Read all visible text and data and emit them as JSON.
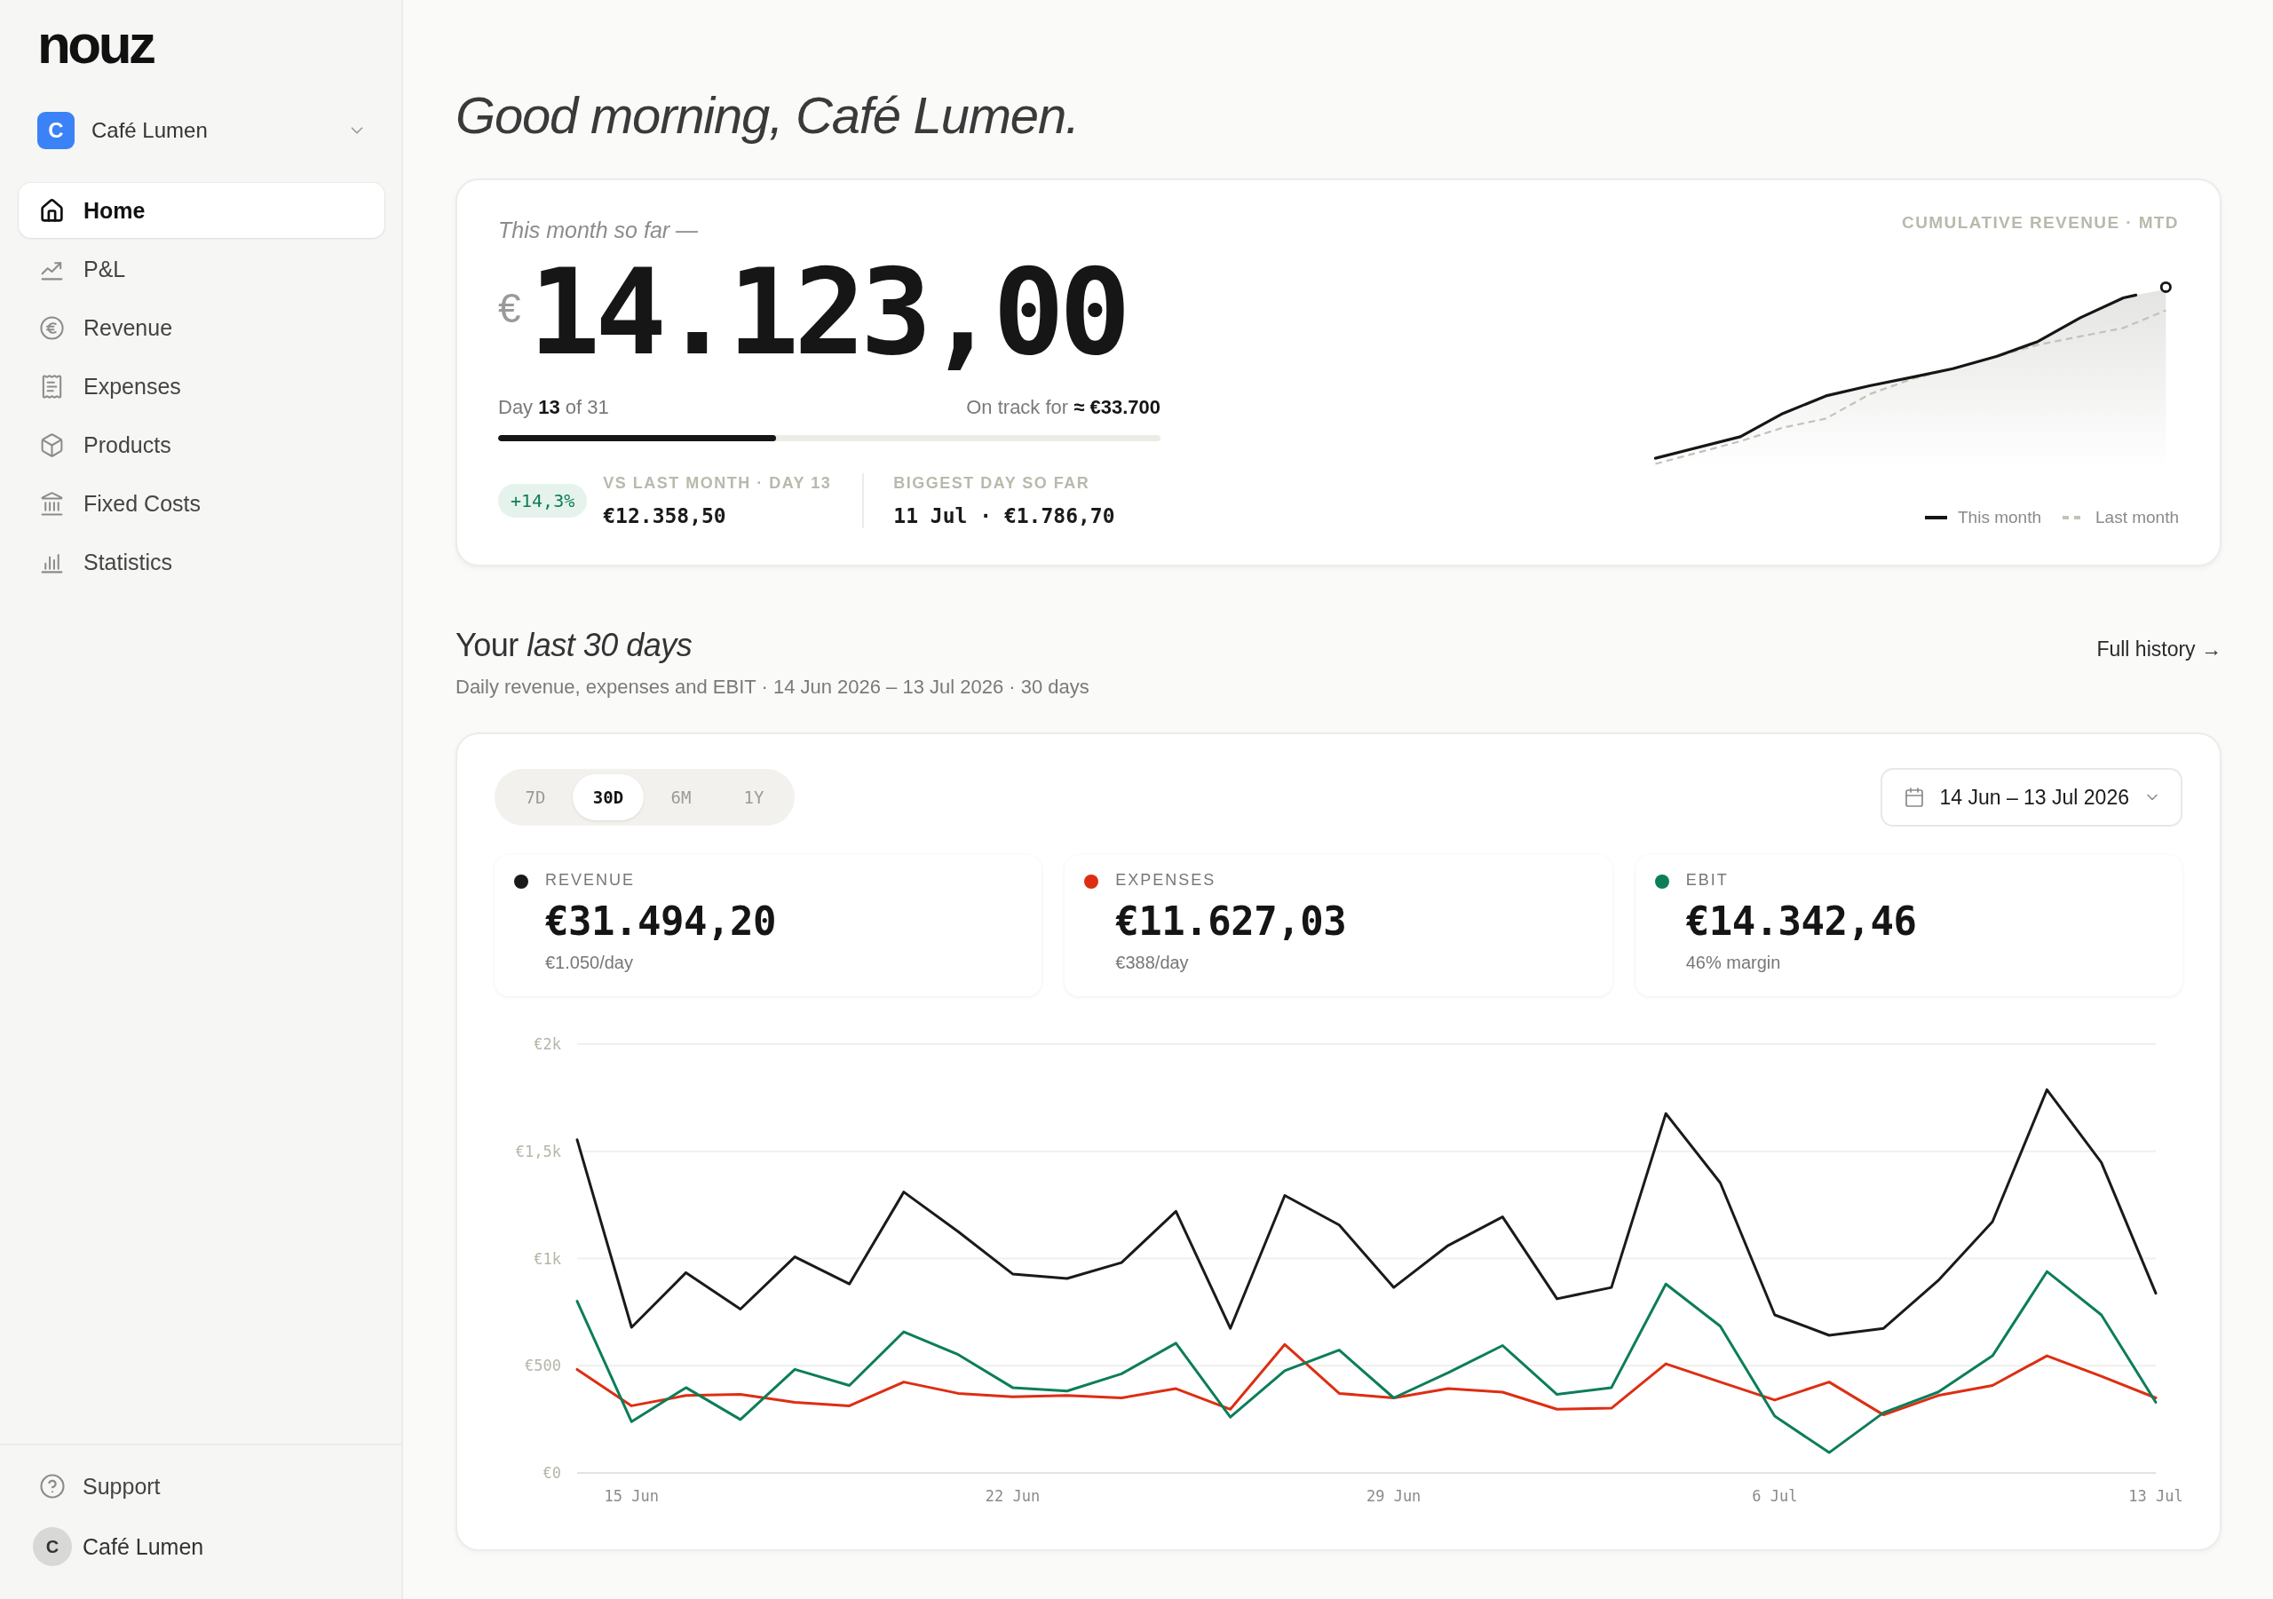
{
  "sidebar": {
    "logo": "nouz",
    "workspace": {
      "initial": "C",
      "name": "Café Lumen"
    },
    "nav": [
      {
        "label": "Home",
        "selected": true
      },
      {
        "label": "P&L",
        "selected": false
      },
      {
        "label": "Revenue",
        "selected": false
      },
      {
        "label": "Expenses",
        "selected": false
      },
      {
        "label": "Products",
        "selected": false
      },
      {
        "label": "Fixed Costs",
        "selected": false
      },
      {
        "label": "Statistics",
        "selected": false
      }
    ],
    "support": "Support",
    "account": {
      "initial": "C",
      "name": "Café Lumen"
    }
  },
  "greeting": "Good morning, Café Lumen.",
  "month_card": {
    "caption": "This month so far —",
    "currency": "€",
    "amount": "14.123,00",
    "day_text": "Day **13** of 31",
    "forecast": "On track for **≈ €33.700**",
    "progress": {
      "level": 0.42
    },
    "change_badge": "+14,3%",
    "comparisons": [
      {
        "label": "VS LAST MONTH · DAY 13",
        "value": "€12.358,50"
      },
      {
        "label": "BIGGEST DAY SO FAR",
        "value": "11 Jul · €1.786,70"
      }
    ],
    "chart_title": "CUMULATIVE REVENUE · MTD",
    "legend": [
      {
        "label": "This month",
        "kind": "solid"
      },
      {
        "label": "Last month",
        "kind": "dashed"
      }
    ]
  },
  "section": {
    "title": "Your *last 30 days*",
    "subtitle": "Daily revenue, expenses and EBIT · 14 Jun 2026 – 13 Jul 2026 · 30 days",
    "link": "Full history →"
  },
  "overview": {
    "range_tabs": [
      {
        "label": "7D",
        "selected": false
      },
      {
        "label": "30D",
        "selected": true
      },
      {
        "label": "6M",
        "selected": false
      },
      {
        "label": "1Y",
        "selected": false
      }
    ],
    "date_range": "14 Jun – 13 Jul 2026",
    "metrics": [
      {
        "label": "REVENUE",
        "value": "€31.494,20",
        "note": "€1.050/day",
        "color": "#1a1a1a"
      },
      {
        "label": "EXPENSES",
        "value": "€11.627,03",
        "note": "€388/day",
        "color": "#dd2e13"
      },
      {
        "label": "EBIT",
        "value": "€14.342,46",
        "note": "46% margin",
        "color": "#0c7d5a"
      }
    ],
    "chart_data": {
      "type": "line",
      "grid": true,
      "categories": [
        null,
        "15 Jun",
        null,
        null,
        null,
        null,
        null,
        null,
        "22 Jun",
        null,
        null,
        null,
        null,
        null,
        null,
        "29 Jun",
        null,
        null,
        null,
        null,
        null,
        null,
        "6 Jul",
        null,
        null,
        null,
        null,
        null,
        null,
        "13 Jul"
      ],
      "series": [
        {
          "color": "#1a1a1a",
          "values": [
            1554,
            679,
            934,
            764,
            1008,
            881,
            1310,
            1125,
            928,
            907,
            981,
            1220,
            674,
            1294,
            1156,
            865,
            1061,
            1194,
            812,
            865,
            1676,
            1353,
            737,
            642,
            674,
            897,
            1172,
            1787,
            1448,
            838
          ]
        },
        {
          "color": "#dd2e13",
          "values": [
            483,
            313,
            361,
            366,
            329,
            313,
            424,
            371,
            355,
            361,
            350,
            393,
            297,
            599,
            371,
            350,
            393,
            377,
            297,
            302,
            509,
            424,
            340,
            424,
            271,
            361,
            408,
            546,
            451,
            350
          ]
        },
        {
          "color": "#0c7d5a",
          "values": [
            801,
            239,
            398,
            249,
            483,
            408,
            658,
            552,
            398,
            382,
            462,
            605,
            260,
            477,
            573,
            350,
            467,
            594,
            366,
            398,
            881,
            684,
            265,
            95,
            281,
            377,
            546,
            939,
            737,
            329
          ]
        }
      ],
      "ylim": [
        0,
        2000
      ],
      "yticks": [
        {
          "value": 0,
          "label": "€0"
        },
        {
          "value": 500,
          "label": "€500"
        },
        {
          "value": 1000,
          "label": "€1k"
        },
        {
          "value": 1500,
          "label": "€1,5k"
        },
        {
          "value": 2000,
          "label": "€2k"
        }
      ]
    }
  }
}
